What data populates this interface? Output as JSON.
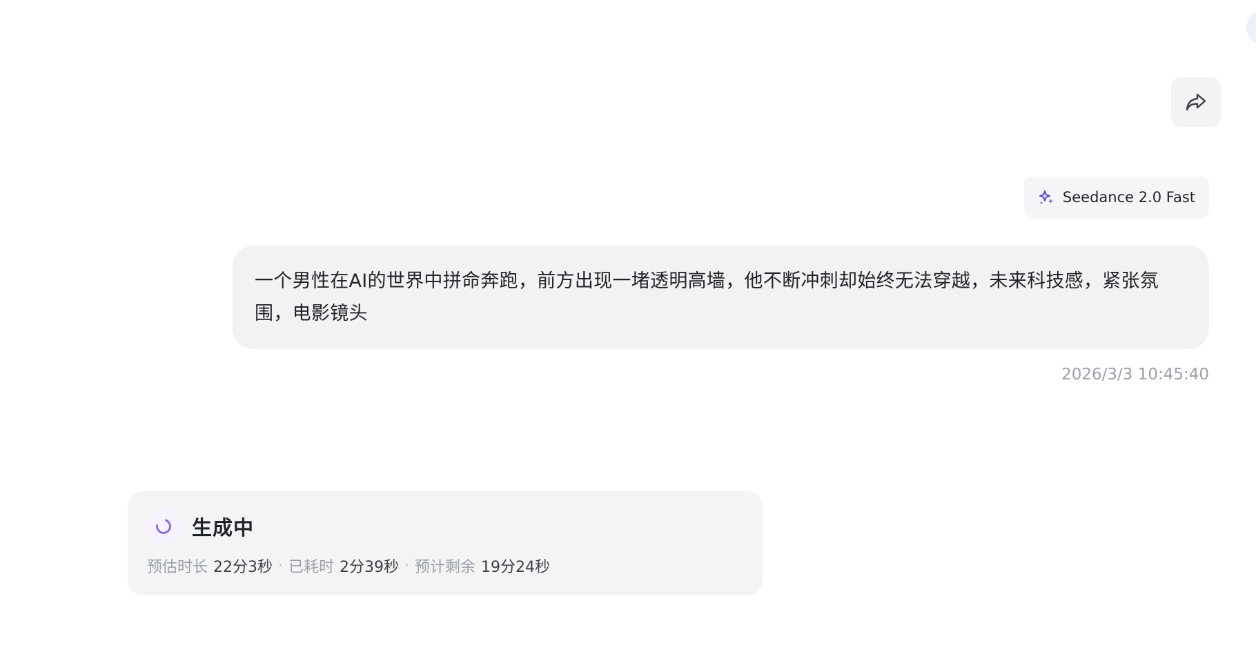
{
  "header": {
    "share_icon": "share-arrow-icon"
  },
  "model": {
    "icon": "sparkle-icon",
    "name": "Seedance 2.0 Fast",
    "accent_color": "#5b4bd6"
  },
  "prompt": {
    "text": "一个男性在AI的世界中拼命奔跑，前方出现一堵透明高墙，他不断冲刺却始终无法穿越，未来科技感，紧张氛围，电影镜头",
    "timestamp": "2026/3/3 10:45:40"
  },
  "generation": {
    "status": "生成中",
    "spinner_color": "#8b6cf0",
    "estimated_label": "预估时长",
    "estimated_value": "22分3秒",
    "elapsed_label": "已耗时",
    "elapsed_value": "2分39秒",
    "remaining_label": "预计剩余",
    "remaining_value": "19分24秒",
    "separator": "·"
  }
}
